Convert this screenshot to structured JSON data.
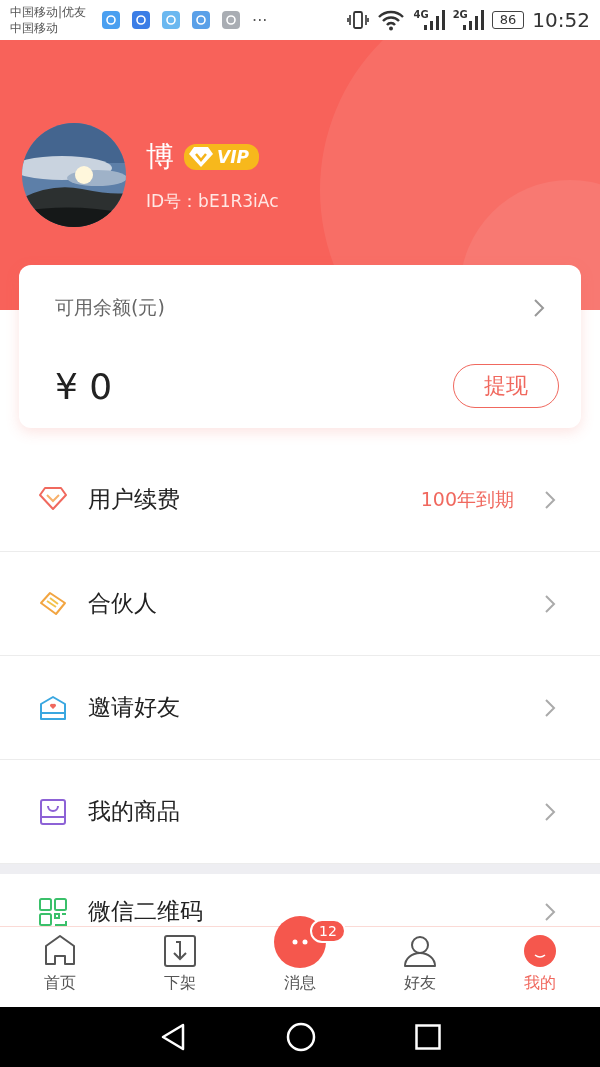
{
  "status_bar": {
    "carrier_lines": [
      "中国移动|优友",
      "中国移动"
    ],
    "overflow": "···",
    "network_labels": [
      "4G",
      "2G"
    ],
    "battery": "86",
    "time": "10:52"
  },
  "profile": {
    "name": "博",
    "badge": "VIP",
    "id": "ID号：bE1R3iAc"
  },
  "balance": {
    "label": "可用余额(元)",
    "amount": "¥ 0",
    "button": "提现"
  },
  "menu_groups": [
    [
      {
        "kind": "diamond",
        "label": "用户续费",
        "value": "100年到期"
      },
      {
        "kind": "handshake",
        "label": "合伙人"
      },
      {
        "kind": "mail",
        "label": "邀请好友"
      },
      {
        "kind": "bag",
        "label": "我的商品"
      }
    ],
    [
      {
        "kind": "qrcode",
        "label": "微信二维码"
      }
    ]
  ],
  "tab_bar": [
    {
      "kind": "home",
      "label": "首页",
      "selected": false
    },
    {
      "kind": "download",
      "label": "下架",
      "selected": false
    },
    {
      "kind": "message",
      "label": "消息",
      "selected": false,
      "badge": "12"
    },
    {
      "kind": "person",
      "label": "好友",
      "selected": false
    },
    {
      "kind": "smile",
      "label": "我的",
      "selected": true
    }
  ]
}
